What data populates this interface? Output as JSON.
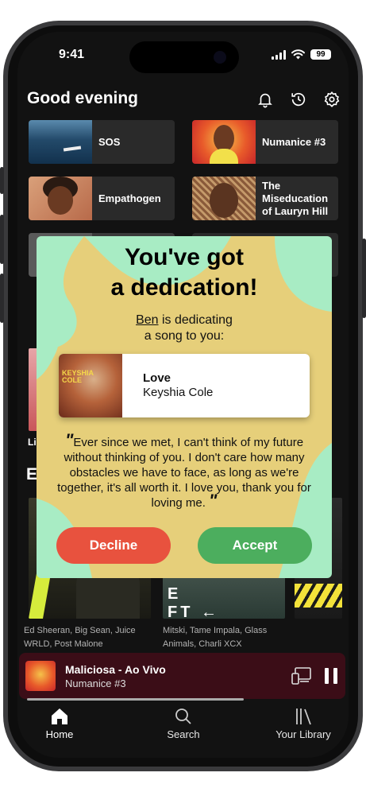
{
  "status": {
    "time": "9:41",
    "battery": "99"
  },
  "header": {
    "greeting": "Good evening"
  },
  "shortcuts": [
    {
      "label": "SOS"
    },
    {
      "label": "Numanice #3"
    },
    {
      "label": "Empathogen"
    },
    {
      "label": "The Miseducation of Lauryn Hill"
    }
  ],
  "hidden_peek": {
    "row_label_start": "Li",
    "section_start": "E"
  },
  "albums_row": [
    {
      "artists": "Ed Sheeran, Big Sean, Juice WRLD, Post Malone"
    },
    {
      "artists": "Mitski, Tame Impala, Glass Animals, Charli XCX"
    }
  ],
  "dedication": {
    "title_line1": "You've got",
    "title_line2": "a dedication!",
    "sender": "Ben",
    "message_suffix": " is dedicating",
    "message_line2": "a song to you:",
    "song": {
      "title": "Love",
      "artist": "Keyshia Cole",
      "cover_text": "KEYSHIA COLE"
    },
    "quote": "Ever since we met, I can't think of my future without thinking of you. I don't care how many obstacles we have to face, as long as we're together, it's all worth it. I love you, thank you for loving me.",
    "decline_label": "Decline",
    "accept_label": "Accept"
  },
  "now_playing": {
    "title": "Maliciosa - Ao Vivo",
    "subtitle": "Numanice #3",
    "progress": 0.7
  },
  "tabs": [
    {
      "label": "Home",
      "active": true
    },
    {
      "label": "Search"
    },
    {
      "label": "Your Library"
    }
  ],
  "colors": {
    "modal_green": "#a8ecc4",
    "modal_yellow": "#e6cf7a",
    "decline": "#e8523e",
    "accept": "#4cae5e",
    "nowplaying_bg": "#3b0d17"
  }
}
